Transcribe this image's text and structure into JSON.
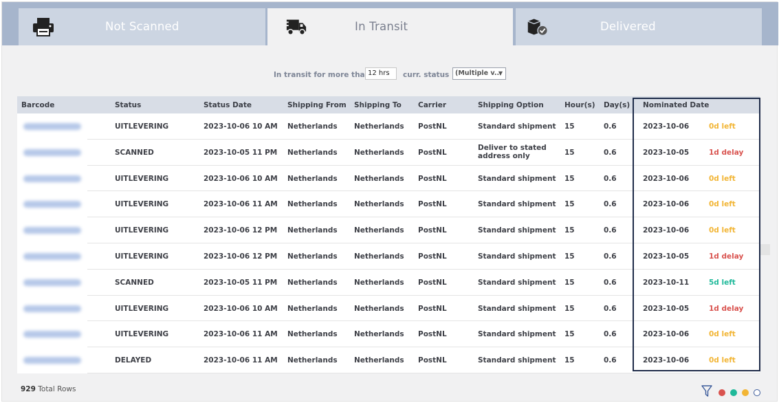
{
  "tabs": [
    {
      "label": "Not Scanned",
      "icon": "printer-icon",
      "active": false
    },
    {
      "label": "In Transit",
      "icon": "truck-icon",
      "active": true
    },
    {
      "label": "Delivered",
      "icon": "package-check-icon",
      "active": false
    }
  ],
  "filters": {
    "transit_label": "In transit for more than",
    "transit_value": "12 hrs",
    "status_label": "curr. status",
    "status_value": "(Multiple v..."
  },
  "table": {
    "headers": [
      "Barcode",
      "Status",
      "Status Date",
      "Shipping From",
      "Shipping To",
      "Carrier",
      "Shipping Option",
      "Hour(s)",
      "Day(s)",
      "Nominated Date"
    ],
    "rows": [
      {
        "status": "UITLEVERING",
        "date": "2023-10-06 10 AM",
        "from": "Netherlands",
        "to": "Netherlands",
        "carrier": "PostNL",
        "option": "Standard shipment",
        "hours": "15",
        "days": "0.6",
        "nominated": "2023-10-06",
        "due": "0d left",
        "due_color": "#f2b535"
      },
      {
        "status": "SCANNED",
        "date": "2023-10-05 11 PM",
        "from": "Netherlands",
        "to": "Netherlands",
        "carrier": "PostNL",
        "option": "Deliver to stated address only",
        "hours": "15",
        "days": "0.6",
        "nominated": "2023-10-05",
        "due": "1d delay",
        "due_color": "#d9534f"
      },
      {
        "status": "UITLEVERING",
        "date": "2023-10-06 10 AM",
        "from": "Netherlands",
        "to": "Netherlands",
        "carrier": "PostNL",
        "option": "Standard shipment",
        "hours": "15",
        "days": "0.6",
        "nominated": "2023-10-06",
        "due": "0d left",
        "due_color": "#f2b535"
      },
      {
        "status": "UITLEVERING",
        "date": "2023-10-06 11 AM",
        "from": "Netherlands",
        "to": "Netherlands",
        "carrier": "PostNL",
        "option": "Standard shipment",
        "hours": "15",
        "days": "0.6",
        "nominated": "2023-10-06",
        "due": "0d left",
        "due_color": "#f2b535"
      },
      {
        "status": "UITLEVERING",
        "date": "2023-10-06 12 PM",
        "from": "Netherlands",
        "to": "Netherlands",
        "carrier": "PostNL",
        "option": "Standard shipment",
        "hours": "15",
        "days": "0.6",
        "nominated": "2023-10-06",
        "due": "0d left",
        "due_color": "#f2b535"
      },
      {
        "status": "UITLEVERING",
        "date": "2023-10-06 12 PM",
        "from": "Netherlands",
        "to": "Netherlands",
        "carrier": "PostNL",
        "option": "Standard shipment",
        "hours": "15",
        "days": "0.6",
        "nominated": "2023-10-05",
        "due": "1d delay",
        "due_color": "#d9534f"
      },
      {
        "status": "SCANNED",
        "date": "2023-10-05 11 PM",
        "from": "Netherlands",
        "to": "Netherlands",
        "carrier": "PostNL",
        "option": "Standard shipment",
        "hours": "15",
        "days": "0.6",
        "nominated": "2023-10-11",
        "due": "5d left",
        "due_color": "#1fb99a"
      },
      {
        "status": "UITLEVERING",
        "date": "2023-10-06 10 AM",
        "from": "Netherlands",
        "to": "Netherlands",
        "carrier": "PostNL",
        "option": "Standard shipment",
        "hours": "15",
        "days": "0.6",
        "nominated": "2023-10-05",
        "due": "1d delay",
        "due_color": "#d9534f"
      },
      {
        "status": "UITLEVERING",
        "date": "2023-10-06 11 AM",
        "from": "Netherlands",
        "to": "Netherlands",
        "carrier": "PostNL",
        "option": "Standard shipment",
        "hours": "15",
        "days": "0.6",
        "nominated": "2023-10-06",
        "due": "0d left",
        "due_color": "#f2b535"
      },
      {
        "status": "DELAYED",
        "date": "2023-10-06 11 AM",
        "from": "Netherlands",
        "to": "Netherlands",
        "carrier": "PostNL",
        "option": "Standard shipment",
        "hours": "15",
        "days": "0.6",
        "nominated": "2023-10-06",
        "due": "0d left",
        "due_color": "#f2b535"
      }
    ]
  },
  "footer": {
    "total_count": "929",
    "total_label": "Total Rows",
    "legend_colors": [
      "#d9534f",
      "#1fb99a",
      "#f2b535",
      "#ffffff"
    ]
  },
  "colors": {
    "tab_bar": "#a6b5cc",
    "tab_inactive": "#ccd5e2",
    "header_bg": "#d8dde6",
    "highlight_border": "#1d2a48"
  }
}
